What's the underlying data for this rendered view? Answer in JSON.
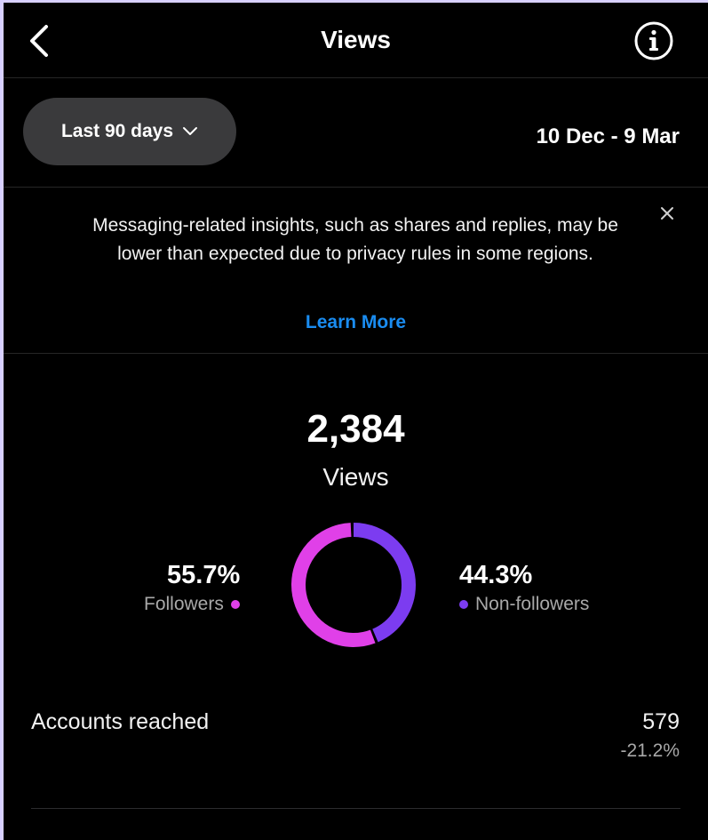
{
  "header": {
    "title": "Views",
    "back_icon": "chevron-left-icon",
    "info_icon": "info-icon"
  },
  "filter": {
    "range_label": "Last 90 days",
    "dropdown_icon": "chevron-down-icon",
    "date_range": "10 Dec - 9 Mar"
  },
  "notice": {
    "text": "Messaging-related insights, such as shares and replies, may be lower than expected due to privacy rules in some regions.",
    "learn_more": "Learn More",
    "close_icon": "close-icon"
  },
  "summary": {
    "value": "2,384",
    "label": "Views"
  },
  "breakdown": {
    "followers": {
      "percent": "55.7%",
      "label": "Followers",
      "fraction": 0.557,
      "color": "#e040e8"
    },
    "non_followers": {
      "percent": "44.3%",
      "label": "Non-followers",
      "fraction": 0.443,
      "color": "#7c3cf0"
    }
  },
  "accounts_reached": {
    "label": "Accounts reached",
    "value": "579",
    "change": "-21.2%"
  },
  "colors": {
    "background": "#000000",
    "pill": "#3a3a3c",
    "link": "#1a8cf0"
  }
}
